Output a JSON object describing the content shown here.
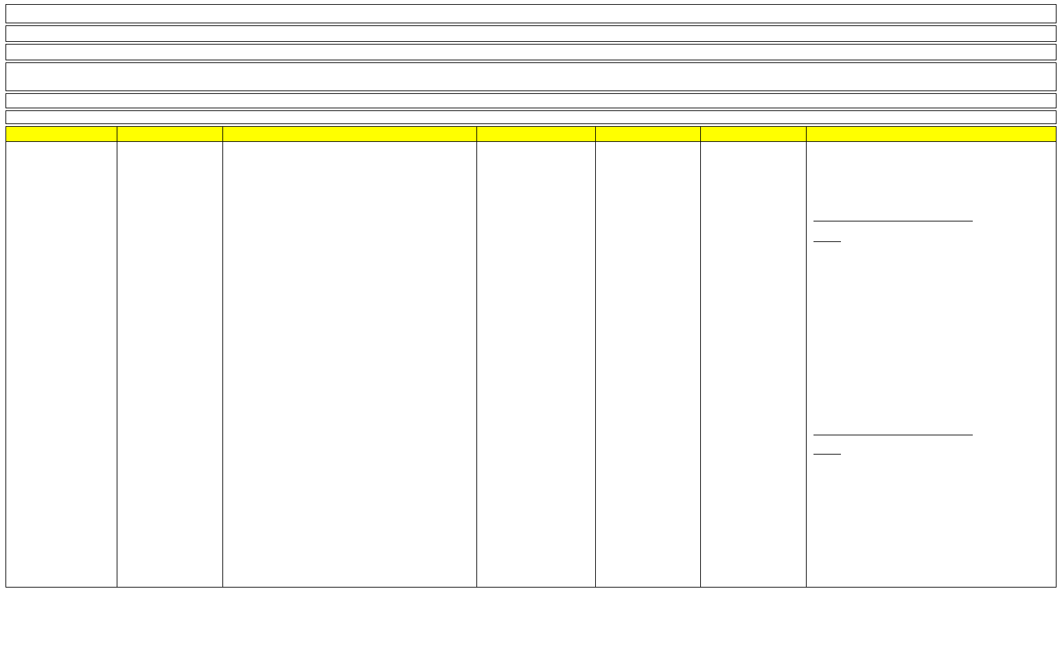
{
  "header_rows": [
    "",
    "",
    "",
    "",
    "",
    ""
  ],
  "table": {
    "headers": [
      "",
      "",
      "",
      "",
      "",
      "",
      ""
    ],
    "row": [
      "",
      "",
      "",
      "",
      "",
      "",
      ""
    ]
  }
}
